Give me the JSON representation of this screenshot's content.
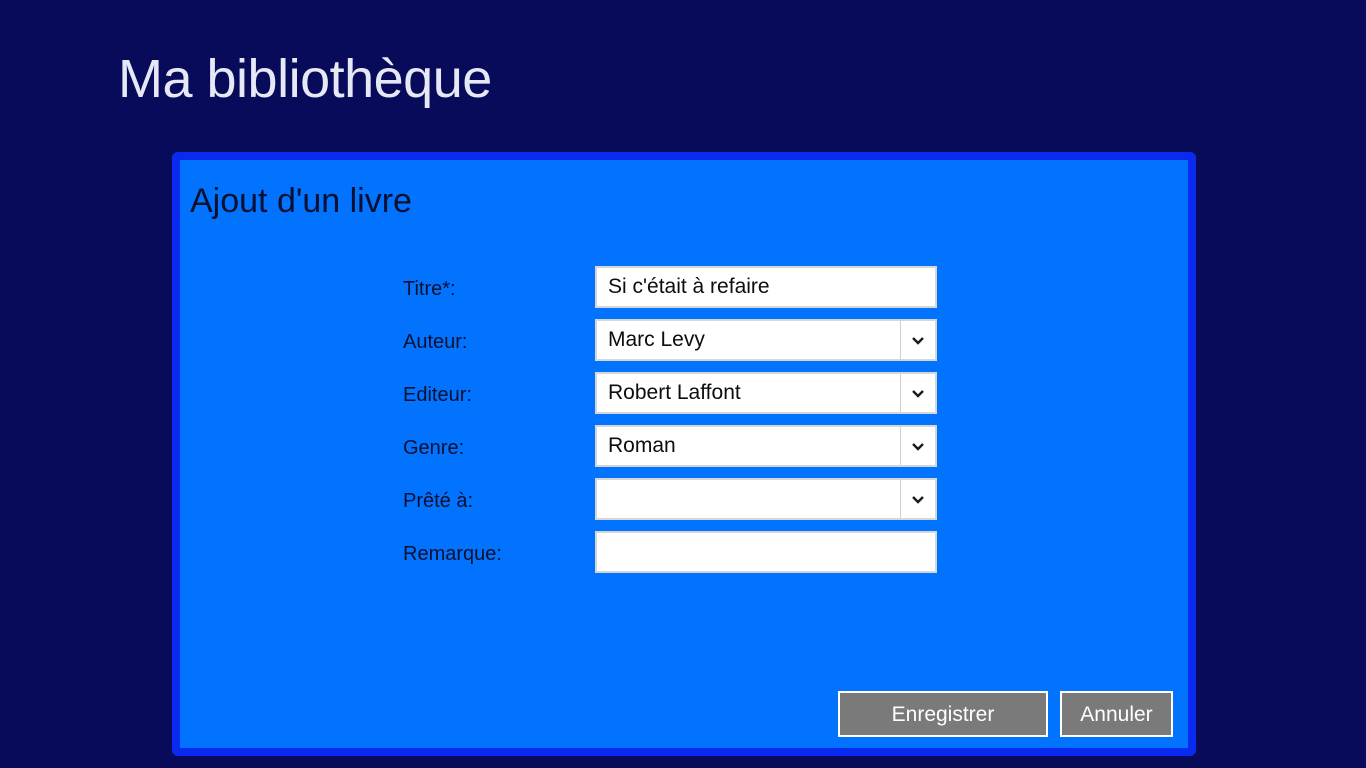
{
  "app": {
    "title": "Ma bibliothèque"
  },
  "dialog": {
    "title": "Ajout d'un livre",
    "fields": [
      {
        "label": "Titre*:",
        "value": "Si c'était à refaire",
        "type": "text"
      },
      {
        "label": "Auteur:",
        "value": "Marc Levy",
        "type": "combobox"
      },
      {
        "label": "Editeur:",
        "value": "Robert Laffont",
        "type": "combobox"
      },
      {
        "label": "Genre:",
        "value": "Roman",
        "type": "combobox"
      },
      {
        "label": "Prêté à:",
        "value": "",
        "type": "combobox"
      },
      {
        "label": "Remarque:",
        "value": "",
        "type": "text"
      }
    ],
    "buttons": {
      "save_label": "Enregistrer",
      "cancel_label": "Annuler"
    }
  },
  "colors": {
    "background": "#070B5A",
    "dialog_background": "#0173FE",
    "dialog_border": "#0A2BEF",
    "button_background": "#7A7A7A"
  },
  "icons": {
    "combobox_arrow": "chevron-down-icon"
  }
}
